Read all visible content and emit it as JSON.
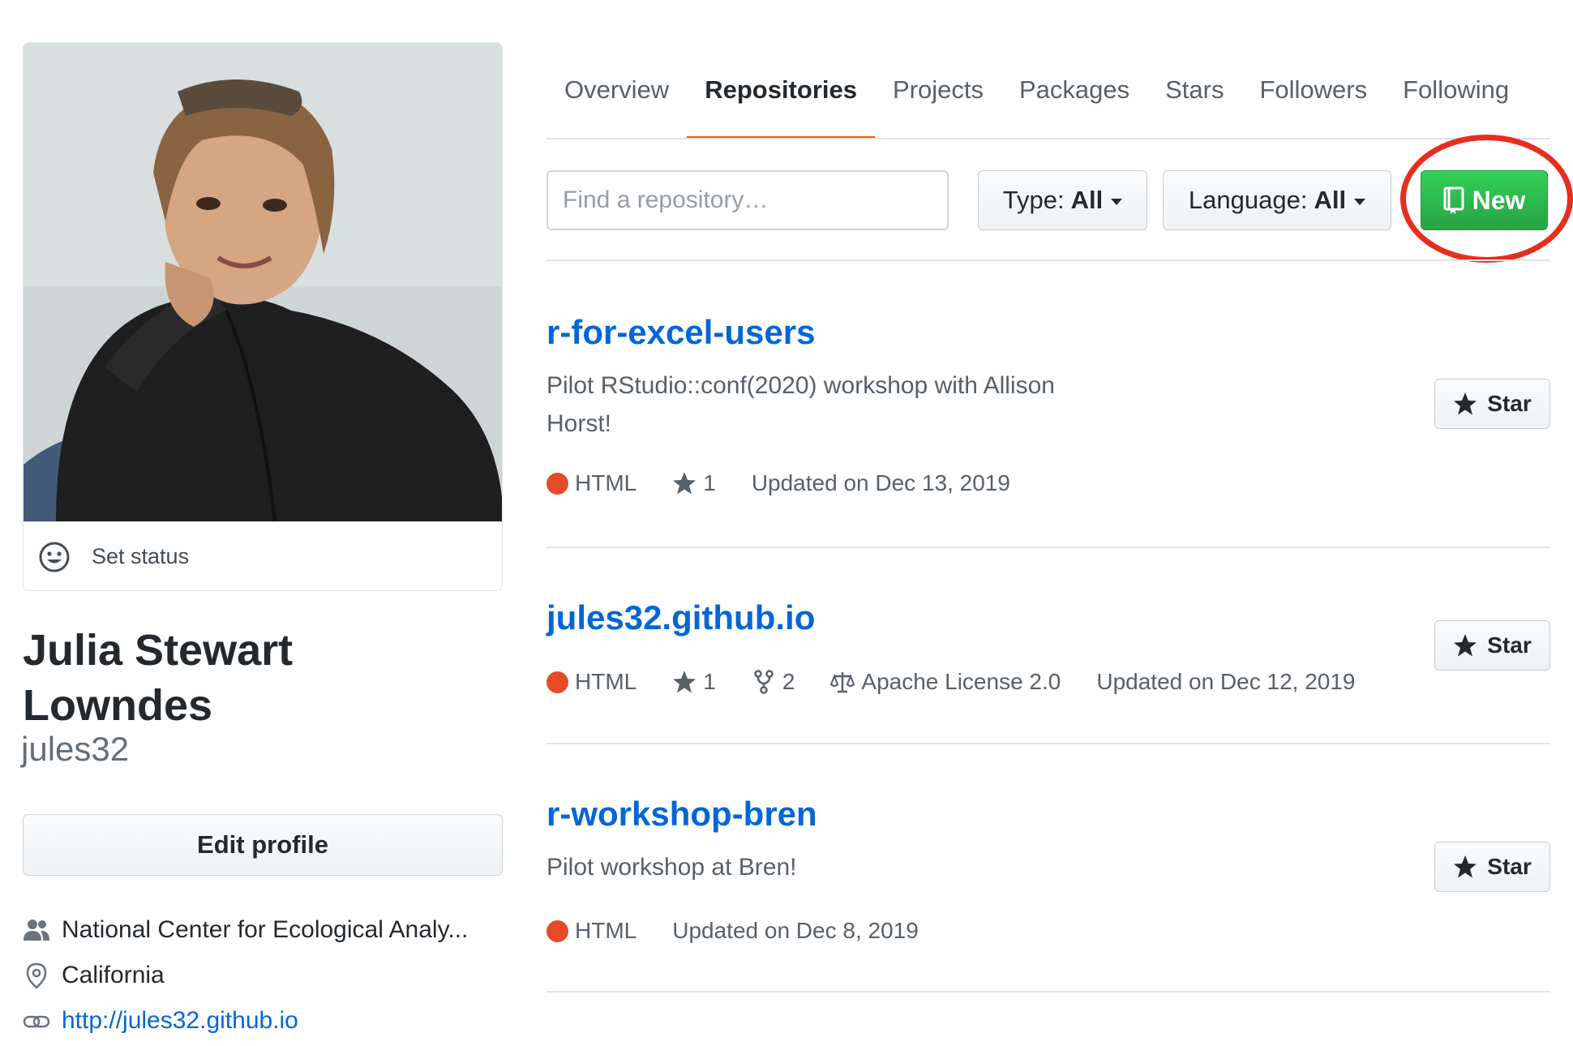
{
  "profile": {
    "set_status_label": "Set status",
    "name_line1": "Julia Stewart",
    "name_line2": "Lowndes",
    "username": "jules32",
    "edit_profile_label": "Edit profile",
    "organization": "National Center for Ecological Analy...",
    "location": "California",
    "website": "http://jules32.github.io"
  },
  "tabs": [
    {
      "label": "Overview"
    },
    {
      "label": "Repositories"
    },
    {
      "label": "Projects"
    },
    {
      "label": "Packages"
    },
    {
      "label": "Stars"
    },
    {
      "label": "Followers"
    },
    {
      "label": "Following"
    }
  ],
  "selected_tab": "Repositories",
  "filters": {
    "search_placeholder": "Find a repository…",
    "type_label": "Type:",
    "type_value": "All",
    "language_label": "Language:",
    "language_value": "All",
    "new_button_label": "New"
  },
  "repositories": [
    {
      "name": "r-for-excel-users",
      "description_line1": "Pilot RStudio::conf(2020) workshop with Allison",
      "description_line2": "Horst!",
      "language": "HTML",
      "stars": "1",
      "updated": "Updated on Dec 13, 2019",
      "star_button": "Star"
    },
    {
      "name": "jules32.github.io",
      "language": "HTML",
      "stars": "1",
      "forks": "2",
      "license": "Apache License 2.0",
      "updated": "Updated on Dec 12, 2019",
      "star_button": "Star"
    },
    {
      "name": "r-workshop-bren",
      "description_line1": "Pilot workshop at Bren!",
      "language": "HTML",
      "updated": "Updated on Dec 8, 2019",
      "star_button": "Star"
    }
  ],
  "colors": {
    "accent_link": "#0366d6",
    "tab_underline": "#e36209",
    "new_button": "#28a745",
    "html_language": "#e34c26",
    "annotation_circle": "#e62e1f"
  }
}
